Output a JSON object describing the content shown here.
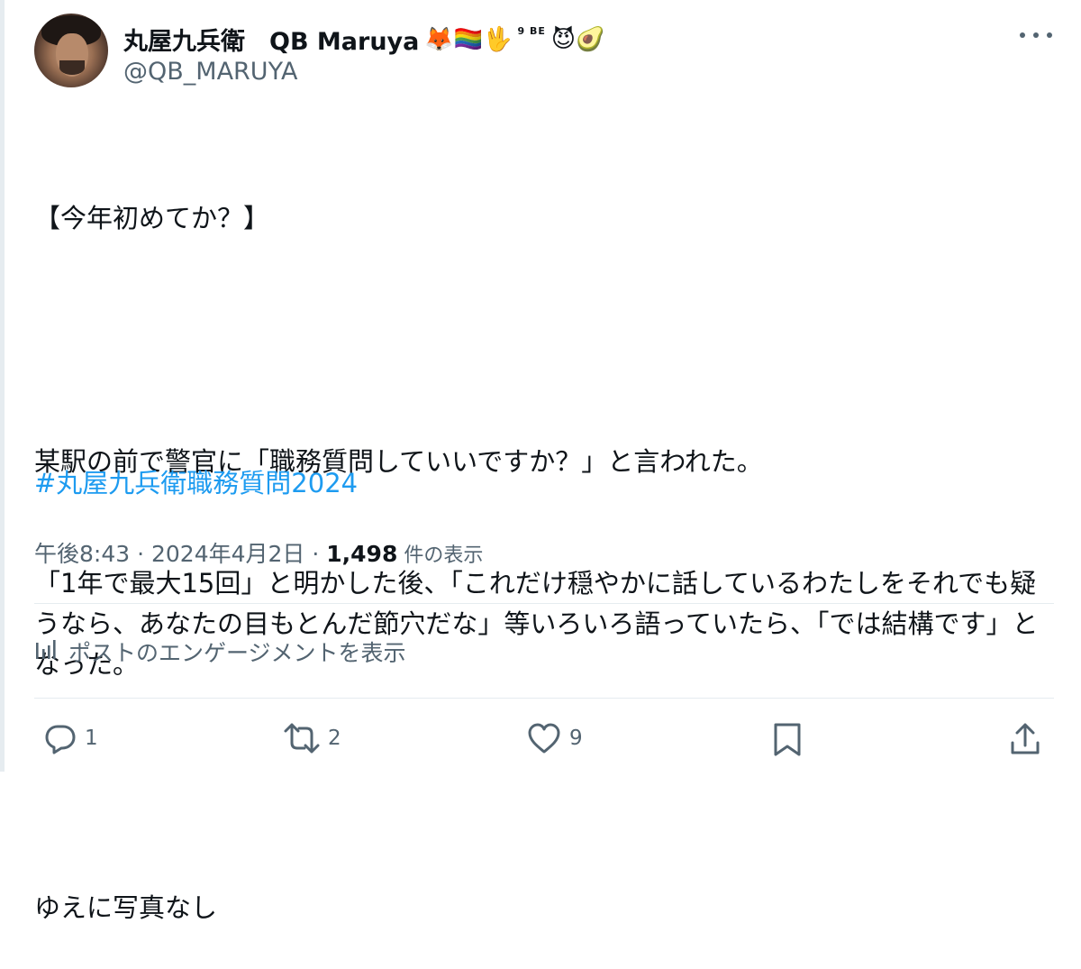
{
  "author": {
    "display_name": "丸屋九兵衛　QB Maruya",
    "name_emoji": "🦊🏳️‍🌈🖖",
    "name_superscripts": "9 BE",
    "name_emoji_tail": "😈🥑",
    "handle": "@QB_MARUYA"
  },
  "tweet": {
    "headline": "【今年初めてか？】",
    "paragraph_1": "某駅の前で警官に「職務質問していいですか？」と言われた。",
    "paragraph_2": "「1年で最大15回」と明かした後、「これだけ穏やかに話しているわたしをそれでも疑うなら、あなたの目もとんだ節穴だな」等いろいろ語っていたら、「では結構です」となった。",
    "paragraph_3": "ゆえに写真なし",
    "hashtag": "#丸屋九兵衛職務質問2024"
  },
  "meta": {
    "time": "午後8:43",
    "separator_1": " · ",
    "date": "2024年4月2日",
    "separator_2": " · ",
    "views_count": "1,498",
    "views_label": " 件の表示"
  },
  "engagement": {
    "label": "ポストのエンゲージメントを表示",
    "icon": "analytics-icon"
  },
  "actions": {
    "reply_count": "1",
    "retweet_count": "2",
    "like_count": "9"
  },
  "colors": {
    "link": "#1d9bf0",
    "secondary_text": "#536471",
    "primary_text": "#0f1419",
    "divider": "#e6ecf0"
  }
}
